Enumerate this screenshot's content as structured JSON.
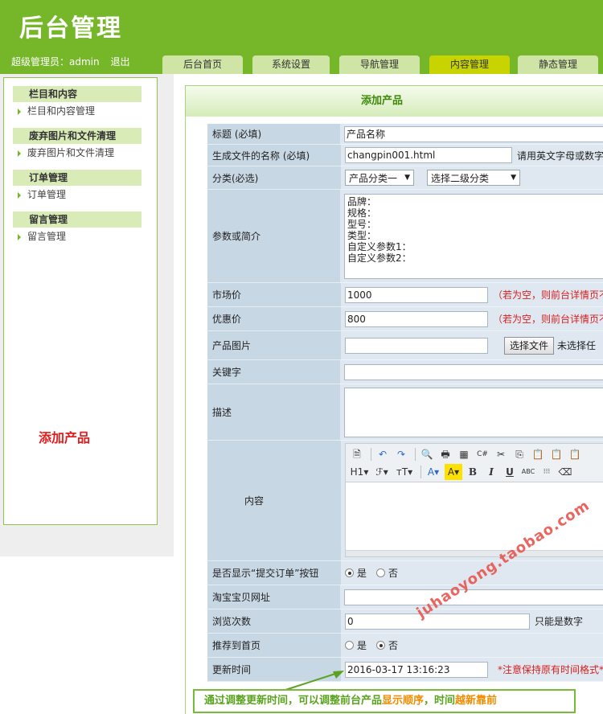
{
  "header": {
    "logo": "后台管理",
    "user_label": "超级管理员：admin",
    "logout": "退出",
    "tabs": [
      "后台首页",
      "系统设置",
      "导航管理",
      "内容管理",
      "静态管理"
    ]
  },
  "sidebar": {
    "groups": [
      {
        "title": "栏目和内容",
        "item": "栏目和内容管理"
      },
      {
        "title": "废弃图片和文件清理",
        "item": "废弃图片和文件清理"
      },
      {
        "title": "订单管理",
        "item": "订单管理"
      },
      {
        "title": "留言管理",
        "item": "留言管理"
      }
    ],
    "callout": "添加产品"
  },
  "panel": {
    "title": "添加产品"
  },
  "form": {
    "title_label": "标题 (必填)",
    "title_value": "产品名称",
    "filename_label": "生成文件的名称 (必填)",
    "filename_value": "changpin001.html",
    "filename_hint": "请用英文字母或数字",
    "category_label": "分类(必选)",
    "category1": "产品分类一",
    "category2": "选择二级分类",
    "params_label": "参数或简介",
    "params_value": "品牌：\n规格：\n型号：\n类型：\n自定义参数1：\n自定义参数2：",
    "market_price_label": "市场价",
    "market_price_value": "1000",
    "market_price_hint": "（若为空，则前台详情页不",
    "sale_price_label": "优惠价",
    "sale_price_value": "800",
    "sale_price_hint": "（若为空，则前台详情页不",
    "image_label": "产品图片",
    "image_button": "选择文件",
    "image_status": "未选择任",
    "keywords_label": "关键字",
    "keywords_value": "",
    "desc_label": "描述",
    "desc_value": "",
    "content_label": "内容",
    "show_order_label": "是否显示“提交订单”按钮",
    "show_order_yes": "是",
    "show_order_no": "否",
    "taobao_label": "淘宝宝贝网址",
    "taobao_value": "",
    "views_label": "浏览次数",
    "views_value": "0",
    "views_hint": "只能是数字",
    "recommend_label": "推荐到首页",
    "recommend_yes": "是",
    "recommend_no": "否",
    "update_label": "更新时间",
    "update_value": "2016-03-17 13:16:23",
    "update_hint": "*注意保持原有时间格式*"
  },
  "editor": {
    "toolbar_row1": [
      "🗎",
      "↶",
      "↷",
      "🔍",
      "🖶",
      "▦",
      "C#",
      "✂",
      "⎘",
      "📋",
      "📋",
      "📋"
    ],
    "toolbar_row2": [
      "H1▾",
      "ℱ▾",
      "ᴛT▾",
      "A▾",
      "A▾",
      "B",
      "I",
      "U",
      "ABC",
      "⁝⁝⁝",
      "⌫"
    ]
  },
  "watermark": "juhaoyong.taobao.com",
  "note": {
    "part1": "通过调整更新时间，可以调整前台产品",
    "part2": "显示顺序",
    "part3": "，时间",
    "part4": "越新靠前"
  }
}
